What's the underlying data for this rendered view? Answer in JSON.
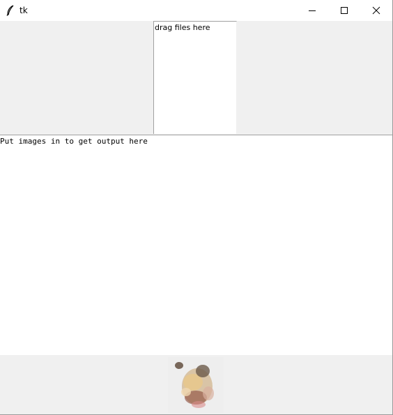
{
  "window": {
    "title": "tk",
    "icon": "feather-icon",
    "controls": {
      "minimize_icon": "minimize-icon",
      "maximize_icon": "maximize-icon",
      "close_icon": "close-icon"
    }
  },
  "drop_zone": {
    "label": "drag files here"
  },
  "output": {
    "text": "Put images in to get output here"
  },
  "preview": {
    "icon": "image-thumbnail"
  },
  "colors": {
    "background": "#f0f0f0",
    "panel": "#ffffff",
    "border": "#a0a0a0"
  }
}
